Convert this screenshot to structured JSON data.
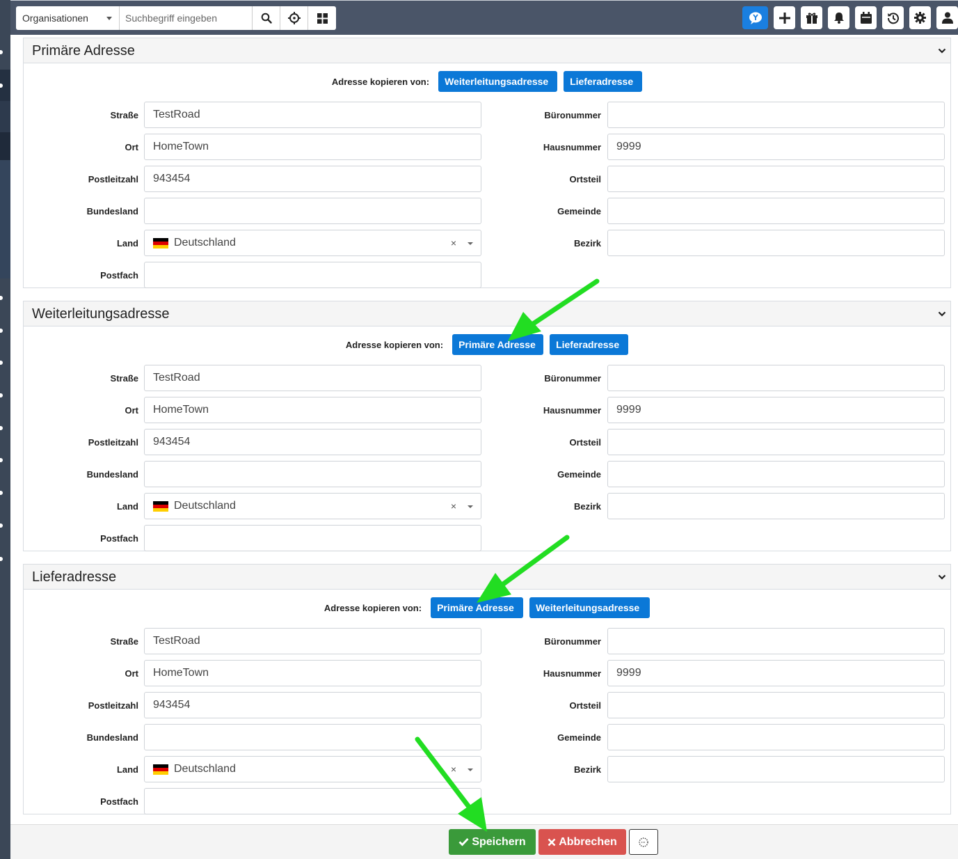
{
  "topbar": {
    "module_select": "Organisationen",
    "search_placeholder": "Suchbegriff eingeben"
  },
  "copy_label": "Adresse kopieren von:",
  "labels": {
    "strasse": "Straße",
    "ort": "Ort",
    "plz": "Postleitzahl",
    "bundesland": "Bundesland",
    "land": "Land",
    "postfach": "Postfach",
    "bueronummer": "Büronummer",
    "hausnummer": "Hausnummer",
    "ortsteil": "Ortsteil",
    "gemeinde": "Gemeinde",
    "bezirk": "Bezirk"
  },
  "panels": [
    {
      "title": "Primäre Adresse",
      "copy_buttons": [
        "Weiterleitungsadresse",
        "Lieferadresse"
      ],
      "values": {
        "strasse": "TestRoad",
        "ort": "HomeTown",
        "plz": "943454",
        "bundesland": "",
        "land": "Deutschland",
        "postfach": "",
        "bueronummer": "",
        "hausnummer": "9999",
        "ortsteil": "",
        "gemeinde": "",
        "bezirk": ""
      }
    },
    {
      "title": "Weiterleitungsadresse",
      "copy_buttons": [
        "Primäre Adresse",
        "Lieferadresse"
      ],
      "values": {
        "strasse": "TestRoad",
        "ort": "HomeTown",
        "plz": "943454",
        "bundesland": "",
        "land": "Deutschland",
        "postfach": "",
        "bueronummer": "",
        "hausnummer": "9999",
        "ortsteil": "",
        "gemeinde": "",
        "bezirk": ""
      }
    },
    {
      "title": "Lieferadresse",
      "copy_buttons": [
        "Primäre Adresse",
        "Weiterleitungsadresse"
      ],
      "values": {
        "strasse": "TestRoad",
        "ort": "HomeTown",
        "plz": "943454",
        "bundesland": "",
        "land": "Deutschland",
        "postfach": "",
        "bueronummer": "",
        "hausnummer": "9999",
        "ortsteil": "",
        "gemeinde": "",
        "bezirk": ""
      }
    }
  ],
  "footer": {
    "save_label": "Speichern",
    "cancel_label": "Abbrechen"
  },
  "colors": {
    "primary_blue": "#0b78d7",
    "save_green": "#3a9a3a",
    "cancel_red": "#d9534f",
    "arrow_green": "#22dd22",
    "topbar": "#4a5568"
  },
  "icons": {
    "search": "search-icon",
    "target": "crosshair-icon",
    "grid": "grid-icon",
    "chat": "chat-bubble-icon",
    "add": "plus-icon",
    "gift": "gift-icon",
    "bell": "bell-icon",
    "calendar": "calendar-icon",
    "history": "history-icon",
    "settings": "gear-icon",
    "user": "user-icon",
    "toggle": "chevron-down-icon",
    "save": "check-icon",
    "cancel": "times-icon",
    "extra": "dotted-circle-icon"
  }
}
